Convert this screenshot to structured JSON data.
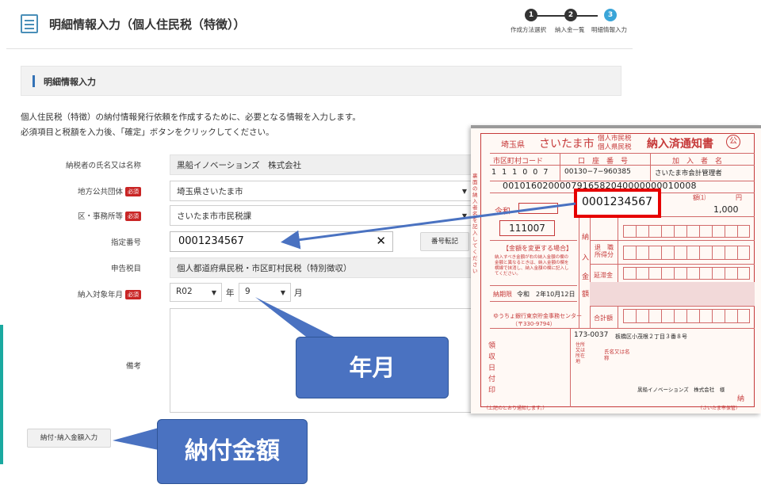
{
  "header": {
    "title": "明細情報入力（個人住民税（特徴））",
    "steps": [
      {
        "num": "1",
        "label": "作成方法選択",
        "state": "done"
      },
      {
        "num": "2",
        "label": "納入金一覧",
        "state": "done"
      },
      {
        "num": "3",
        "label": "明細情報入力",
        "state": "current"
      }
    ]
  },
  "section": {
    "title": "明細情報入力",
    "intro_line1": "個人住民税（特徴）の納付情報発行依頼を作成するために、必要となる情報を入力します。",
    "intro_line2": "必須項目と税額を入力後、「確定」ボタンをクリックしてください。"
  },
  "form": {
    "required_badge": "必須",
    "taxpayer_label": "納税者の氏名又は名称",
    "taxpayer_value": "黒船イノベーションズ　株式会社",
    "municipality_label": "地方公共団体",
    "municipality_value": "埼玉県さいたま市",
    "office_label": "区・事務所等",
    "office_value": "さいたま市市民税課",
    "designation_label": "指定番号",
    "designation_value": "0001234567",
    "transfer_button": "番号転記",
    "tax_label": "申告税目",
    "tax_value": "個人都道府県民税・市区町村民税（特別徴収）",
    "period_label": "納入対象年月",
    "year_value": "R02",
    "year_unit": "年",
    "month_value": "9",
    "month_unit": "月",
    "remarks_label": "備考",
    "amount_button": "納付･納入金額入力"
  },
  "callouts": {
    "year_month": "年月",
    "amount": "納付金額"
  },
  "slip": {
    "prefecture": "埼玉県",
    "city": "さいたま市",
    "tax_line1": "個人市民税",
    "tax_line2": "個人県民税",
    "doc_title": "納入済通知書",
    "stamp": "公",
    "col_city_code": "市区町村コード",
    "col_account": "口　座　番　号",
    "col_subscriber": "加　入　者　名",
    "city_code": "1 1 1 0 0 7",
    "account": "00130−7−960385",
    "subscriber": "さいたま市会計管理者",
    "barcode_number": "0010160200007916582040000000010008",
    "designation_highlight": "0001234567",
    "amount_header": "額⑴",
    "yen": "円",
    "amount": "1,000",
    "era": "令和",
    "code_box": "111007",
    "change_notice": "【金額を変更する場合】",
    "deadline_label": "納期限",
    "deadline": "令和　2年10月12日",
    "bank": "ゆうちょ銀行東京貯金事務センター",
    "postal": "（〒330-9794）",
    "row_retire": "退　職\n所得分",
    "row_late": "延滞金",
    "row_total": "合計額",
    "receipt_stamp": "領収日付印",
    "zip": "173-0037",
    "address": "板橋区小茂根２丁目３番８号",
    "addr_label": "住所又は所在地",
    "name_label": "氏名又は名称",
    "payer_name": "黒船イノベーションズ　株式会社　様",
    "footer_left": "（上記のとおり通知します。）",
    "footer_right": "（さいたま市保管）",
    "payee_mark": "納",
    "side_text": "裏面の納入者名を記入してください",
    "row_label_pay": "納",
    "row_label_in": "入",
    "row_label_gold": "金",
    "row_label_amt": "額"
  },
  "colors": {
    "accent": "#3372b6",
    "required": "#c92525",
    "callout": "#4a72c1",
    "slip_red": "#c63a3a",
    "highlight": "#e60000",
    "arrow": "#4a72c1"
  }
}
